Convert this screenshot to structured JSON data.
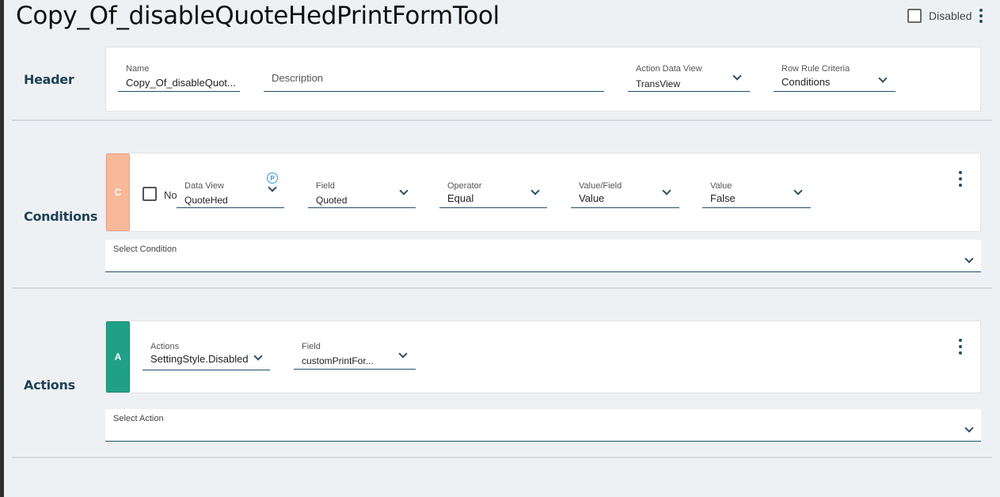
{
  "page": {
    "title": "Copy_Of_disableQuoteHedPrintFormTool",
    "disabled_label": "Disabled"
  },
  "header": {
    "section_label": "Header",
    "name": {
      "label": "Name",
      "value": "Copy_Of_disableQuot..."
    },
    "description": {
      "placeholder": "Description"
    },
    "action_data_view": {
      "label": "Action Data View",
      "value": "TransView"
    },
    "row_rule_criteria": {
      "label": "Row Rule Criteria",
      "value": "Conditions"
    }
  },
  "conditions": {
    "section_label": "Conditions",
    "tag": "C",
    "no_label": "No",
    "data_view": {
      "label": "Data View",
      "value": "QuoteHed"
    },
    "param_icon": "P",
    "field": {
      "label": "Field",
      "value": "Quoted"
    },
    "operator": {
      "label": "Operator",
      "value": "Equal"
    },
    "value_field": {
      "label": "Value/Field",
      "value": "Value"
    },
    "value": {
      "label": "Value",
      "value": "False"
    },
    "select_label": "Select Condition"
  },
  "actions": {
    "section_label": "Actions",
    "tag": "A",
    "actions_field": {
      "label": "Actions",
      "value": "SettingStyle.Disabled"
    },
    "field": {
      "label": "Field",
      "value": "customPrintFor..."
    },
    "select_label": "Select Action"
  },
  "colors": {
    "background": "#eef1f4",
    "accent": "#1f4f6e",
    "condition_tag": "#f8b89a",
    "action_tag": "#20a187",
    "param_icon": "#2a9fd6"
  }
}
